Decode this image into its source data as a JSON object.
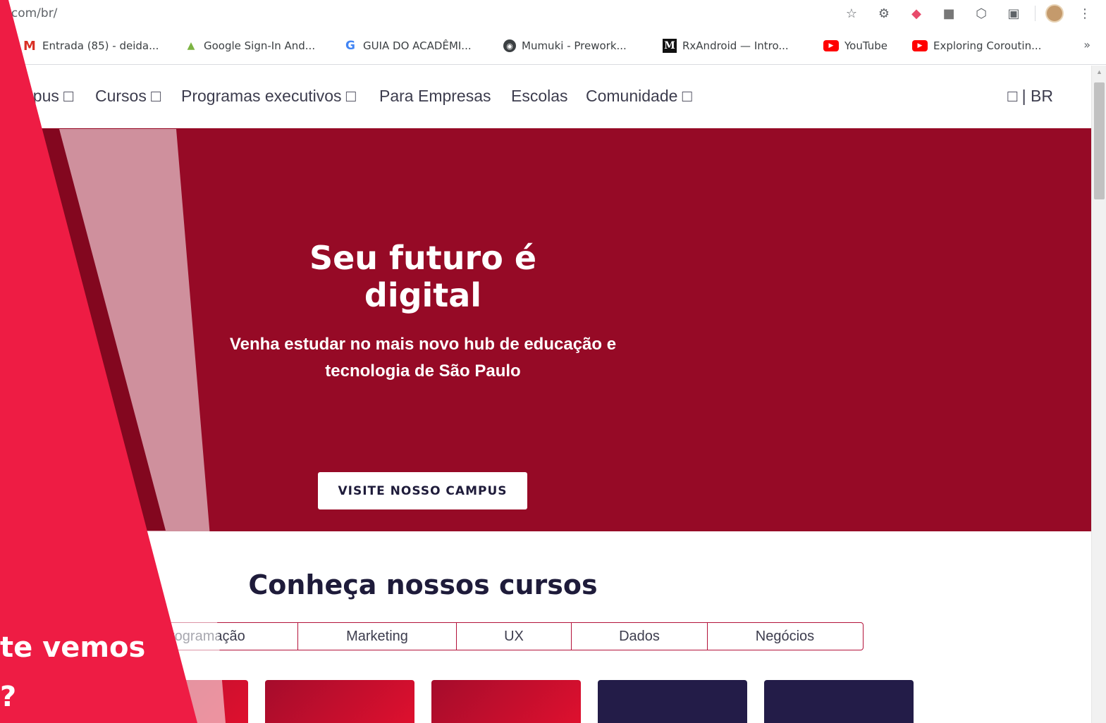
{
  "browser": {
    "url": "e.com/br/",
    "toolbar_icons": [
      "star-icon",
      "gear-extension-icon",
      "arrow-extension-icon",
      "image-extension-icon",
      "shield-extension-icon",
      "picture-in-picture-icon",
      "profile-avatar",
      "kebab-menu-icon"
    ],
    "bookmarks": [
      {
        "label": "Entrada (85) - deida...",
        "icon": "gmail-icon"
      },
      {
        "label": "Google Sign-In And...",
        "icon": "android-icon"
      },
      {
        "label": "GUIA DO ACADÊMI...",
        "icon": "google-icon"
      },
      {
        "label": "Mumuki - Prework...",
        "icon": "mumuki-icon"
      },
      {
        "label": "RxAndroid — Intro...",
        "icon": "medium-icon"
      },
      {
        "label": "YouTube",
        "icon": "youtube-icon"
      },
      {
        "label": "Exploring Coroutin...",
        "icon": "youtube-icon"
      }
    ],
    "more": "»"
  },
  "site_nav": {
    "items": [
      "npus □",
      "Cursos □",
      "Programas executivos □",
      "Para Empresas",
      "Escolas",
      "Comunidade □"
    ],
    "right": "□ | BR"
  },
  "hero": {
    "title_line1": "Seu futuro é",
    "title_line2": "digital",
    "subtitle_line1": "Venha estudar no mais novo hub de educação e",
    "subtitle_line2": "tecnologia de São Paulo",
    "cta": "VISITE NOSSO CAMPUS",
    "background_color": "#960a26"
  },
  "courses": {
    "title": "Conheça nossos cursos",
    "tabs": [
      "rogramação",
      "Marketing",
      "UX",
      "Dados",
      "Negócios"
    ]
  },
  "overlay": {
    "line1": "te vemos",
    "line2": "?",
    "accent_color": "#ee1c44"
  }
}
